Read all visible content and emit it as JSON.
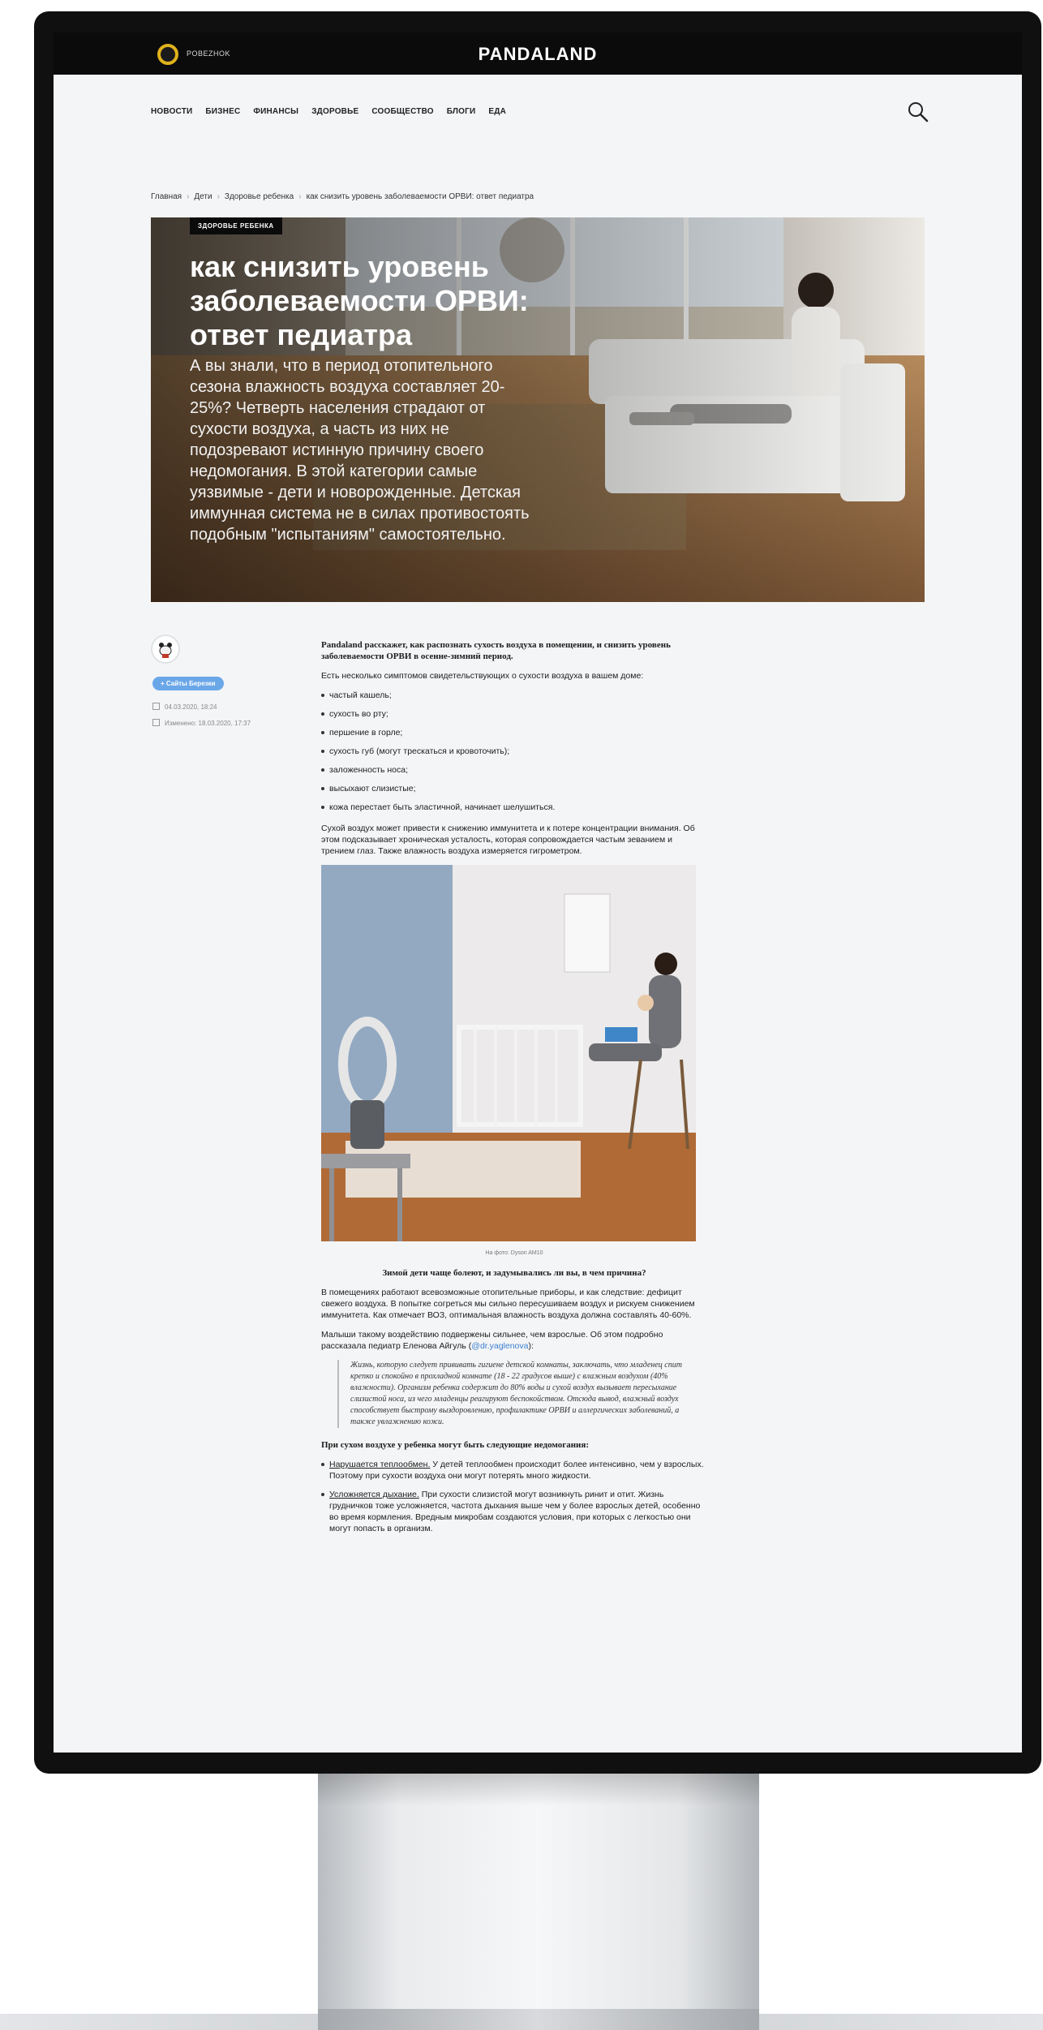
{
  "site": {
    "brand": "PANDALAND",
    "logo_small": "POBEZHOK",
    "nav": [
      "НОВОСТИ",
      "БИЗНЕС",
      "ФИНАНСЫ",
      "ЗДОРОВЬЕ",
      "СООБЩЕСТВО",
      "БЛОГИ",
      "ЕДА"
    ]
  },
  "breadcrumb": [
    "Главная",
    "Дети",
    "Здоровье ребенка",
    "как снизить уровень заболеваемости ОРВИ: ответ педиатра"
  ],
  "hero": {
    "badge": "ЗДОРОВЬЕ РЕБЕНКА",
    "title": "как снизить уровень заболеваемости ОРВИ: ответ педиатра",
    "lead": "А вы знали, что в период отопительного сезона влажность воздуха составляет 20-25%? Четверть населения страдают от сухости воздуха, а часть из них не подозревают истинную причину своего недомогания. В этой категории самые уязвимые - дети и новорожденные. Детская иммунная система не в силах противостоять подобным \"испытаниям\" самостоятельно."
  },
  "author": {
    "tag": "+ Сайты Березки",
    "date_published": "04.03.2020, 18:24",
    "date_updated": "Изменено: 18.03.2020, 17:37"
  },
  "article": {
    "lead": "Pandaland расскажет, как распознать сухость воздуха в помещении, и снизить уровень заболеваемости ОРВИ в осенне-зимний период.",
    "intro": "Есть несколько симптомов свидетельствующих о сухости воздуха в вашем доме:",
    "symptoms": [
      "частый кашель;",
      "сухость во рту;",
      "першение в горле;",
      "сухость губ (могут трескаться и кровоточить);",
      "заложенность носа;",
      "высыхают слизистые;",
      "кожа перестает быть эластичной, начинает шелушиться."
    ],
    "para1": "Сухой воздух может привести к снижению иммунитета и к потере концентрации внимания. Об этом подсказывает хроническая усталость, которая сопровождается частым зеванием и трением глаз. Также влажность воздуха измеряется гигрометром.",
    "caption": "На фото: Dyson AM10",
    "subheading": "Зимой дети чаще болеют, и задумывались ли вы, в чем причина?",
    "para2": "В помещениях работают всевозможные отопительные приборы, и как следствие: дефицит свежего воздуха. В попытке согреться мы сильно пересушиваем воздух и рискуем снижением иммунитета. Как отмечает ВОЗ, оптимальная влажность воздуха должна составлять 40-60%.",
    "para3_text": "Малыши такому воздействию подвержены сильнее, чем взрослые. Об этом подробно рассказала педиатр Еленова Айгуль (",
    "para3_link": "@dr.yaglenova",
    "para3_end": "):",
    "quote": "Жизнь, которую следует прививать гигиене детской комнаты, заключать, что младенец спит крепко и спокойно в прохладной комнате (18 - 22 градусов выше) с влажным воздухом (40% влажности). Организм ребенка содержит до 80% воды и сухой воздух вызывает пересыхание слизистой носа, из чего младенцы реагируют беспокойством. Отсюда вывод, влажный воздух способствует быстрому выздоровлению, профилактике ОРВИ и аллергических заболеваний, а также увлажнению кожи.",
    "subheading2": "При сухом воздухе у ребенка могут быть следующие недомогания:",
    "issues": [
      {
        "title": "Нарушается теплообмен.",
        "text": " У детей теплообмен происходит более интенсивно, чем у взрослых. Поэтому при сухости воздуха они могут потерять много жидкости."
      },
      {
        "title": "Усложняется дыхание.",
        "text": " При сухости слизистой могут возникнуть ринит и отит. Жизнь грудничков тоже усложняется, частота дыхания выше чем у более взрослых детей, особенно во время кормления. Вредным микробам создаются условия, при которых с легкостью они могут попасть в организм."
      }
    ]
  },
  "colors": {
    "accent": "#6aa7e8",
    "topbar": "#0b0b0b",
    "logo_ring": "#e0b21c",
    "page_bg": "#f4f5f6"
  },
  "icons": [
    "search-icon",
    "calendar-icon",
    "clock-icon",
    "avatar-icon"
  ]
}
